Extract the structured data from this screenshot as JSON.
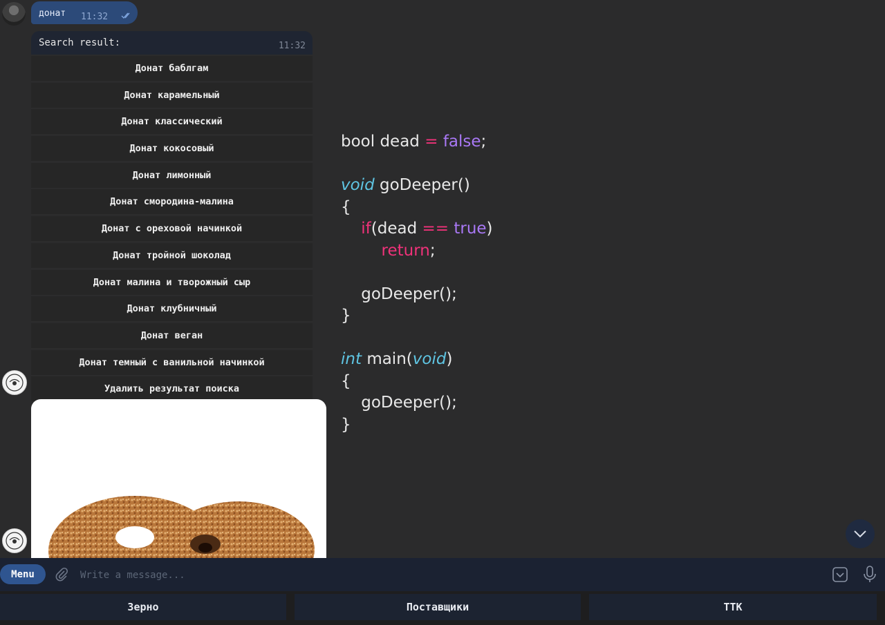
{
  "chat": {
    "outgoing": {
      "text": "донат",
      "time": "11:32"
    },
    "search": {
      "text": "Search result:",
      "time": "11:32"
    },
    "buttons": [
      "Донат баблгам",
      "Донат карамельный",
      "Донат классический",
      "Донат кокосовый",
      "Донат лимонный",
      "Донат смородина-малина",
      "Донат с ореховой начинкой",
      "Донат тройной шоколад",
      "Донат малина и творожный сыр",
      "Донат клубничный",
      "Донат веган",
      "Донат темный с ванильной начинкой",
      "Удалить результат поиска"
    ]
  },
  "code": {
    "l1": {
      "type": "bool",
      "name": "dead",
      "op": "=",
      "val": "false",
      "end": ";"
    },
    "l3": {
      "kw": "void",
      "rest": "goDeeper()"
    },
    "l4": "{",
    "l5": {
      "kw": "if",
      "a": "(dead ",
      "op": "==",
      "val": "true",
      "b": ")"
    },
    "l6": {
      "kw": "return",
      "end": ";"
    },
    "l8": "goDeeper();",
    "l9": "}",
    "l11": {
      "kw": "int",
      "mid": "main(",
      "kw2": "void",
      "end": ")"
    },
    "l12": "{",
    "l13": "goDeeper();",
    "l14": "}"
  },
  "input": {
    "menu_label": "Menu",
    "placeholder": "Write a message..."
  },
  "reply_keyboard": [
    "Зерно",
    "Поставщики",
    "ТТК"
  ],
  "colors": {
    "accent": "#2f5590",
    "keyword_pink": "#f0327a",
    "keyword_purple": "#a978f5",
    "keyword_cyan": "#5fc5e3"
  }
}
